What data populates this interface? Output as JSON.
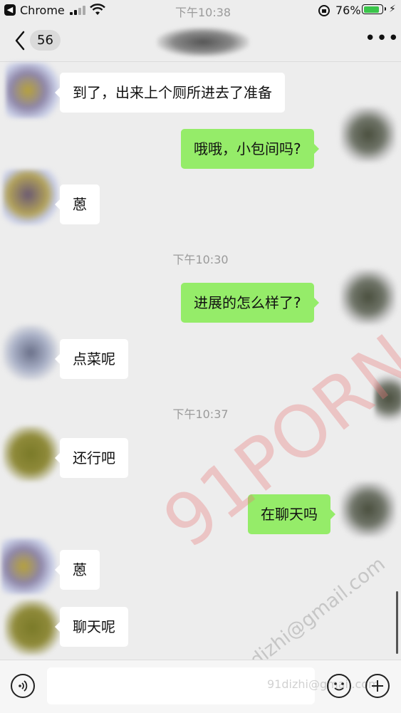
{
  "status_bar": {
    "back_app": "Chrome",
    "clock": "下午10:38",
    "battery_percent": "76%",
    "battery_level": 0.76,
    "battery_color": "#3ac54a"
  },
  "nav": {
    "unread_count": "56",
    "more_label": "•••"
  },
  "messages": [
    {
      "side": "in",
      "text": "到了，出来上个厕所进去了准备"
    },
    {
      "side": "out",
      "text": "哦哦，小包间吗?"
    },
    {
      "side": "in",
      "text": "蒽"
    },
    {
      "side": "time",
      "text": "下午10:30"
    },
    {
      "side": "out",
      "text": "进展的怎么样了?"
    },
    {
      "side": "in",
      "text": "点菜呢"
    },
    {
      "side": "time",
      "text": "下午10:37"
    },
    {
      "side": "in",
      "text": "还行吧"
    },
    {
      "side": "out",
      "text": "在聊天吗"
    },
    {
      "side": "in",
      "text": "蒽"
    },
    {
      "side": "in",
      "text": "聊天呢"
    }
  ],
  "watermarks": {
    "brand": "91PORN",
    "email": "91dizhi@gmail.com",
    "small": "91dizhi@gmail.com"
  },
  "colors": {
    "outgoing_bubble": "#95ec69",
    "incoming_bubble": "#ffffff",
    "background": "#ededed"
  },
  "icons": {
    "voice": "voice-icon",
    "emoji": "emoji-icon",
    "plus": "plus-icon",
    "back": "chevron-left-icon",
    "more": "more-dots-icon"
  }
}
